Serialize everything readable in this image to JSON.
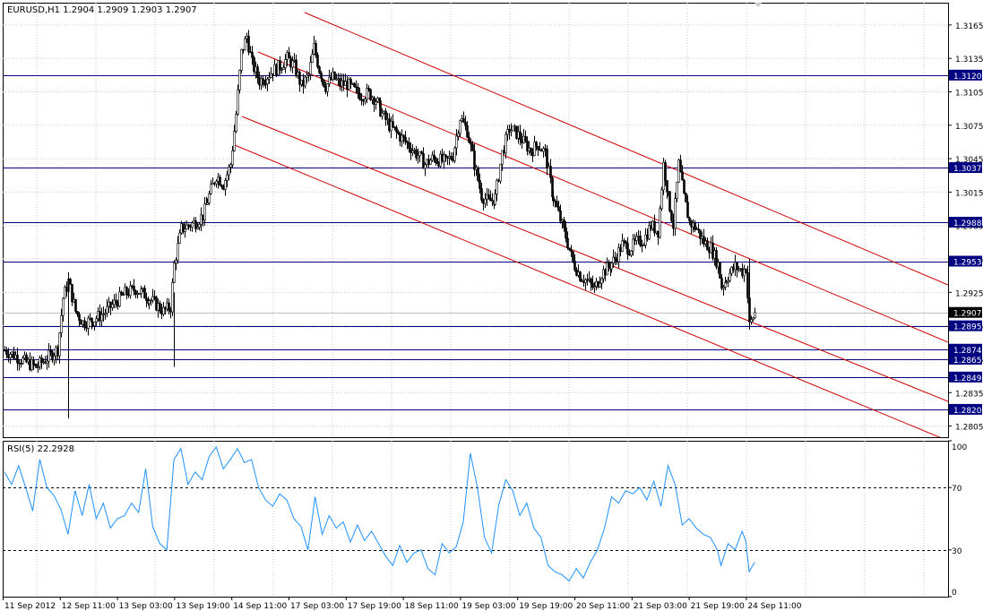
{
  "chart_data": [
    {
      "type": "candlestick",
      "symbol_header": "EURUSD,H1  1.2904 1.2909 1.2903 1.2907",
      "ylim": [
        1.2795,
        1.3185
      ],
      "y_ticks": [
        "1.3165",
        "1.3135",
        "1.3105",
        "1.3075",
        "1.3045",
        "1.3015",
        "1.2985",
        "1.2955",
        "1.2925",
        "1.2895",
        "1.2865",
        "1.2835",
        "1.2805"
      ],
      "x_tick_labels": [
        "11 Sep 2012",
        "12 Sep 11:00",
        "13 Sep 03:00",
        "13 Sep 19:00",
        "14 Sep 11:00",
        "17 Sep 03:00",
        "17 Sep 19:00",
        "18 Sep 11:00",
        "19 Sep 03:00",
        "19 Sep 19:00",
        "20 Sep 11:00",
        "21 Sep 03:00",
        "21 Sep 19:00",
        "24 Sep 11:00"
      ],
      "horizontal_levels": [
        "1.3120",
        "1.3037",
        "1.2988",
        "1.2953",
        "1.2895",
        "1.2874",
        "1.2865",
        "1.2849",
        "1.2820"
      ],
      "current_price": "1.2907",
      "channel_lines": [
        {
          "from": [
            0,
            1.2845
          ],
          "to": [
            0,
            1.2845
          ]
        }
      ],
      "price_path": [
        [
          0,
          1.2873
        ],
        [
          6,
          1.2868
        ],
        [
          12,
          1.2862
        ],
        [
          18,
          1.2858
        ],
        [
          24,
          1.2866
        ],
        [
          30,
          1.2874
        ],
        [
          33,
          1.292
        ],
        [
          36,
          1.2935
        ],
        [
          40,
          1.2908
        ],
        [
          44,
          1.2898
        ],
        [
          50,
          1.29
        ],
        [
          56,
          1.2906
        ],
        [
          62,
          1.2915
        ],
        [
          68,
          1.2924
        ],
        [
          74,
          1.2928
        ],
        [
          80,
          1.2922
        ],
        [
          86,
          1.2914
        ],
        [
          90,
          1.2908
        ],
        [
          94,
          1.2912
        ],
        [
          96,
          1.295
        ],
        [
          100,
          1.2982
        ],
        [
          104,
          1.2985
        ],
        [
          108,
          1.2988
        ],
        [
          112,
          1.2994
        ],
        [
          116,
          1.3012
        ],
        [
          120,
          1.303
        ],
        [
          124,
          1.3022
        ],
        [
          128,
          1.304
        ],
        [
          131,
          1.3085
        ],
        [
          134,
          1.314
        ],
        [
          137,
          1.3155
        ],
        [
          140,
          1.313
        ],
        [
          144,
          1.3115
        ],
        [
          148,
          1.3118
        ],
        [
          152,
          1.3124
        ],
        [
          156,
          1.3128
        ],
        [
          160,
          1.3135
        ],
        [
          164,
          1.3128
        ],
        [
          168,
          1.311
        ],
        [
          172,
          1.312
        ],
        [
          175,
          1.3145
        ],
        [
          178,
          1.3125
        ],
        [
          182,
          1.311
        ],
        [
          186,
          1.3118
        ],
        [
          190,
          1.3112
        ],
        [
          194,
          1.3112
        ],
        [
          198,
          1.3106
        ],
        [
          202,
          1.3102
        ],
        [
          206,
          1.3104
        ],
        [
          210,
          1.3098
        ],
        [
          214,
          1.3085
        ],
        [
          218,
          1.3075
        ],
        [
          222,
          1.3068
        ],
        [
          226,
          1.3062
        ],
        [
          230,
          1.3055
        ],
        [
          234,
          1.3048
        ],
        [
          238,
          1.304
        ],
        [
          242,
          1.3045
        ],
        [
          246,
          1.3044
        ],
        [
          250,
          1.3042
        ],
        [
          254,
          1.3048
        ],
        [
          258,
          1.3082
        ],
        [
          262,
          1.307
        ],
        [
          266,
          1.304
        ],
        [
          270,
          1.3012
        ],
        [
          274,
          1.3006
        ],
        [
          278,
          1.301
        ],
        [
          282,
          1.305
        ],
        [
          286,
          1.3072
        ],
        [
          290,
          1.3068
        ],
        [
          294,
          1.306
        ],
        [
          298,
          1.3052
        ],
        [
          302,
          1.3058
        ],
        [
          306,
          1.305
        ],
        [
          310,
          1.3015
        ],
        [
          314,
          1.2995
        ],
        [
          318,
          1.2975
        ],
        [
          322,
          1.2952
        ],
        [
          326,
          1.294
        ],
        [
          330,
          1.2935
        ],
        [
          334,
          1.2928
        ],
        [
          338,
          1.2942
        ],
        [
          342,
          1.2948
        ],
        [
          346,
          1.2955
        ],
        [
          350,
          1.2968
        ],
        [
          354,
          1.2964
        ],
        [
          358,
          1.297
        ],
        [
          362,
          1.2972
        ],
        [
          366,
          1.2985
        ],
        [
          370,
          1.298
        ],
        [
          373,
          1.304
        ],
        [
          376,
          1.301
        ],
        [
          379,
          1.2985
        ],
        [
          382,
          1.304
        ],
        [
          385,
          1.301
        ],
        [
          388,
          1.2988
        ],
        [
          392,
          1.2982
        ],
        [
          396,
          1.297
        ],
        [
          400,
          1.2965
        ],
        [
          404,
          1.295
        ],
        [
          406,
          1.293
        ],
        [
          410,
          1.294
        ],
        [
          414,
          1.2948
        ],
        [
          418,
          1.2944
        ],
        [
          420,
          1.2947
        ],
        [
          422,
          1.2895
        ],
        [
          425,
          1.2907
        ]
      ]
    },
    {
      "type": "line",
      "title": "RSI(5) 22.2928",
      "ylim": [
        0,
        100
      ],
      "y_ticks": [
        "100",
        "70",
        "30",
        "0"
      ],
      "levels": [
        70,
        30
      ],
      "series": [
        {
          "values": [
            [
              0,
              80
            ],
            [
              4,
              72
            ],
            [
              8,
              84
            ],
            [
              12,
              70
            ],
            [
              16,
              55
            ],
            [
              20,
              88
            ],
            [
              24,
              70
            ],
            [
              28,
              65
            ],
            [
              32,
              56
            ],
            [
              36,
              40
            ],
            [
              40,
              68
            ],
            [
              44,
              52
            ],
            [
              48,
              72
            ],
            [
              52,
              50
            ],
            [
              56,
              60
            ],
            [
              60,
              44
            ],
            [
              64,
              50
            ],
            [
              68,
              52
            ],
            [
              72,
              60
            ],
            [
              76,
              54
            ],
            [
              80,
              82
            ],
            [
              84,
              45
            ],
            [
              88,
              34
            ],
            [
              92,
              30
            ],
            [
              96,
              88
            ],
            [
              100,
              95
            ],
            [
              104,
              72
            ],
            [
              108,
              80
            ],
            [
              112,
              75
            ],
            [
              116,
              90
            ],
            [
              120,
              96
            ],
            [
              124,
              82
            ],
            [
              128,
              88
            ],
            [
              132,
              95
            ],
            [
              136,
              86
            ],
            [
              140,
              88
            ],
            [
              144,
              70
            ],
            [
              148,
              62
            ],
            [
              152,
              58
            ],
            [
              156,
              66
            ],
            [
              160,
              62
            ],
            [
              164,
              50
            ],
            [
              168,
              45
            ],
            [
              172,
              30
            ],
            [
              176,
              64
            ],
            [
              180,
              40
            ],
            [
              184,
              52
            ],
            [
              188,
              44
            ],
            [
              192,
              48
            ],
            [
              196,
              35
            ],
            [
              200,
              46
            ],
            [
              204,
              36
            ],
            [
              208,
              42
            ],
            [
              212,
              34
            ],
            [
              216,
              26
            ],
            [
              220,
              20
            ],
            [
              224,
              33
            ],
            [
              228,
              22
            ],
            [
              232,
              28
            ],
            [
              236,
              30
            ],
            [
              240,
              18
            ],
            [
              244,
              14
            ],
            [
              248,
              34
            ],
            [
              252,
              28
            ],
            [
              256,
              32
            ],
            [
              260,
              48
            ],
            [
              264,
              92
            ],
            [
              268,
              70
            ],
            [
              272,
              38
            ],
            [
              276,
              28
            ],
            [
              280,
              58
            ],
            [
              284,
              75
            ],
            [
              288,
              68
            ],
            [
              292,
              52
            ],
            [
              296,
              60
            ],
            [
              300,
              44
            ],
            [
              304,
              38
            ],
            [
              308,
              20
            ],
            [
              312,
              16
            ],
            [
              316,
              14
            ],
            [
              320,
              10
            ],
            [
              324,
              18
            ],
            [
              328,
              12
            ],
            [
              332,
              22
            ],
            [
              336,
              30
            ],
            [
              340,
              44
            ],
            [
              344,
              64
            ],
            [
              348,
              60
            ],
            [
              352,
              68
            ],
            [
              356,
              66
            ],
            [
              360,
              70
            ],
            [
              364,
              62
            ],
            [
              368,
              74
            ],
            [
              372,
              58
            ],
            [
              376,
              84
            ],
            [
              380,
              72
            ],
            [
              384,
              46
            ],
            [
              388,
              50
            ],
            [
              392,
              44
            ],
            [
              396,
              40
            ],
            [
              400,
              38
            ],
            [
              404,
              30
            ],
            [
              406,
              20
            ],
            [
              410,
              34
            ],
            [
              414,
              30
            ],
            [
              418,
              42
            ],
            [
              420,
              36
            ],
            [
              422,
              16
            ],
            [
              425,
              22
            ]
          ]
        }
      ]
    }
  ]
}
